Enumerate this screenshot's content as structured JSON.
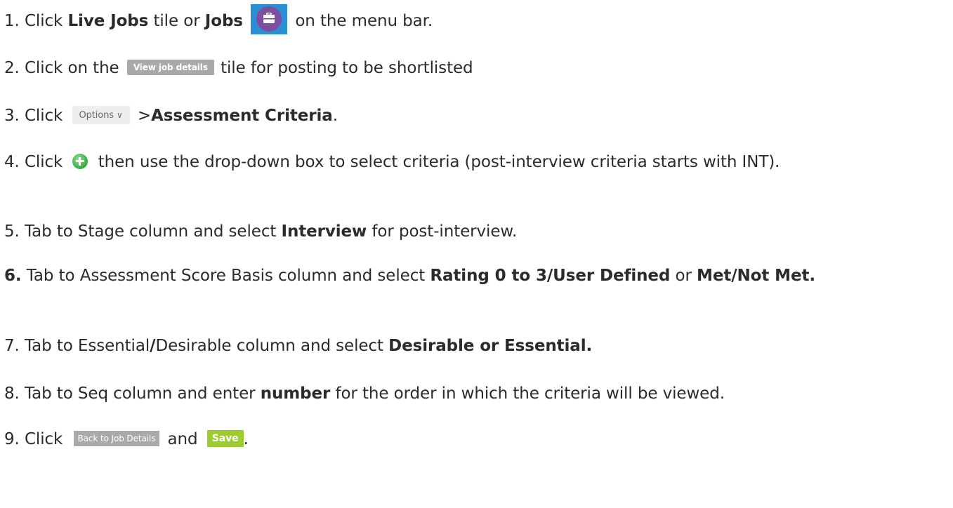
{
  "steps": {
    "s1": {
      "num": "1.",
      "t1": "Click ",
      "b1": "Live Jobs",
      "t2": " tile or ",
      "b2": "Jobs",
      "icon": "briefcase-icon",
      "t3": " on the menu bar."
    },
    "s2": {
      "num": "2.",
      "t1": "Click on the ",
      "button": "View job details",
      "t2": " tile for posting to be shortlisted"
    },
    "s3": {
      "num": "3.",
      "t1": "Click ",
      "button": "Options",
      "chev": "∨",
      "t2": " >",
      "b1": "Assessment Criteria",
      "t3": "."
    },
    "s4": {
      "num": "4.",
      "t1": "Click ",
      "icon": "add-circle-icon",
      "t2": " then use the drop-down box to select criteria (post-interview criteria starts with INT)."
    },
    "s5": {
      "num": "5.",
      "t1": "Tab to Stage column and select ",
      "b1": "Interview",
      "t2": " for post-interview."
    },
    "s6": {
      "num": "6.",
      "t1": "Tab to Assessment Score Basis column and select ",
      "b1": "Rating 0 to 3/User Defined",
      "t2": " or ",
      "b2": "Met/Not Met."
    },
    "s7": {
      "num": "7.",
      "t1": "Tab to Essential",
      "b1": "/",
      "t2": "Desirable column and select ",
      "b2": "Desirable or Essential."
    },
    "s8": {
      "num": "8.",
      "t1": "Tab to Seq column and enter ",
      "b1": "number",
      "t2": " for the order in which the criteria will be viewed."
    },
    "s9": {
      "num": "9.",
      "t1": "Click ",
      "button1": "Back to Job Details",
      "t2": " and ",
      "button2": "Save",
      "t3": "."
    }
  },
  "colors": {
    "jobs_icon_bg": "#2a8fd4",
    "jobs_icon_circle": "#7e4fa0",
    "view_button_bg": "#a9a9a9",
    "options_button_bg": "#eeeeee",
    "add_icon": "#3fb34a",
    "save_button_bg": "#9ccc2f"
  }
}
